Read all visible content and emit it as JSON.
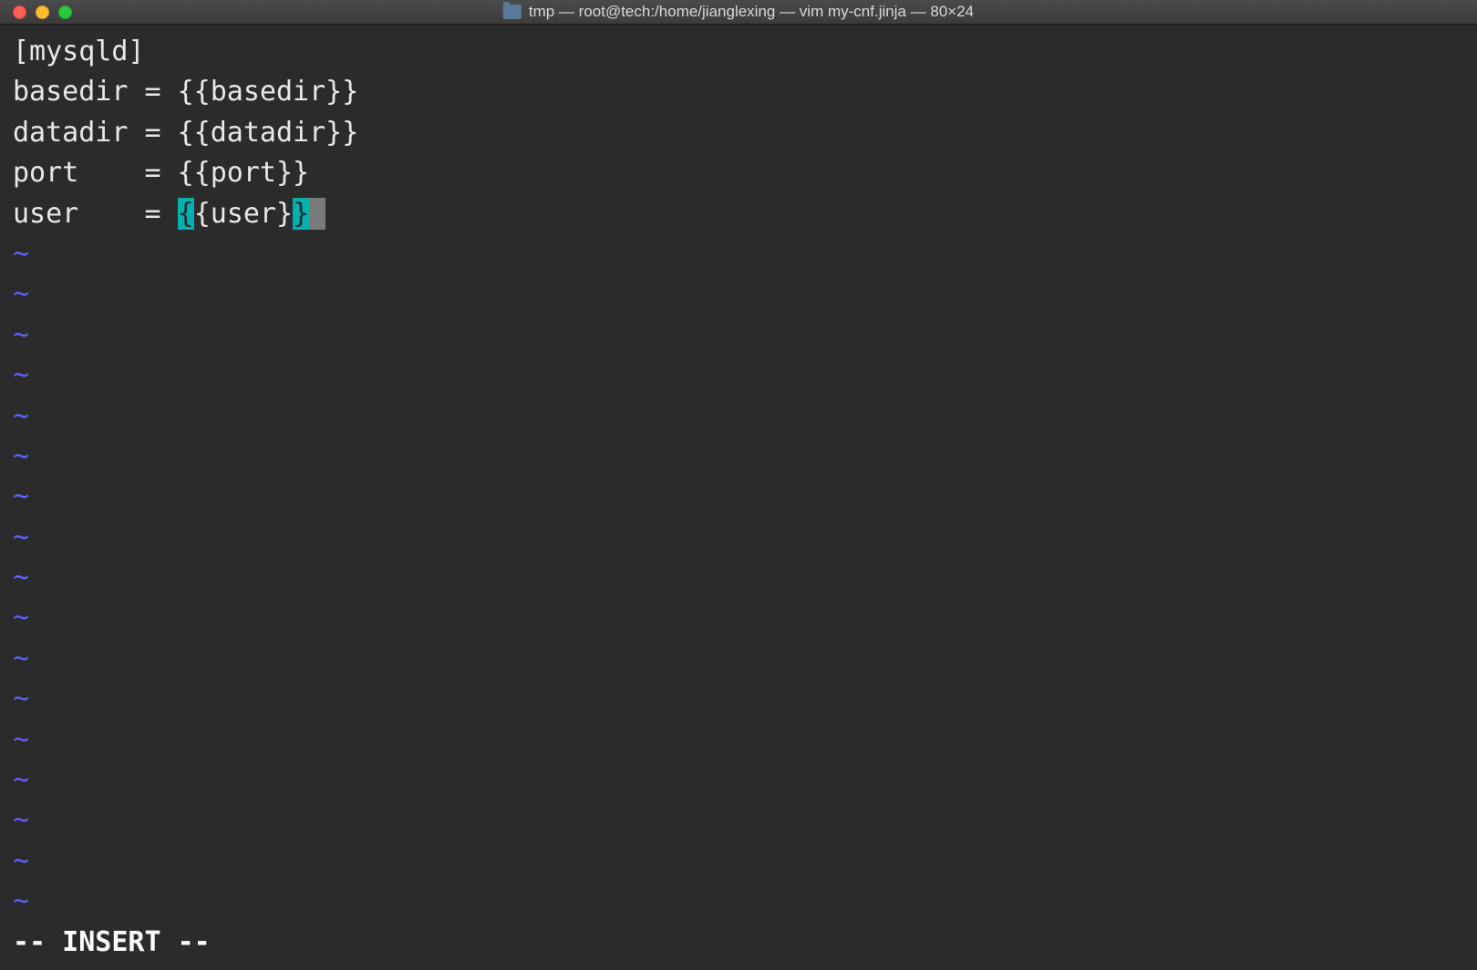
{
  "window": {
    "title": "tmp — root@tech:/home/jianglexing — vim my-cnf.jinja — 80×24"
  },
  "editor": {
    "lines": [
      "[mysqld]",
      "basedir = {{basedir}}",
      "datadir = {{datadir}}",
      "port    = {{port}}"
    ],
    "cursor_line": {
      "before": "user    = ",
      "match_open": "{",
      "mid": "{user}",
      "match_close": "}",
      "cursor_char": " "
    },
    "tilde_count": 17,
    "tilde_char": "~"
  },
  "status": {
    "mode": "-- INSERT --"
  }
}
